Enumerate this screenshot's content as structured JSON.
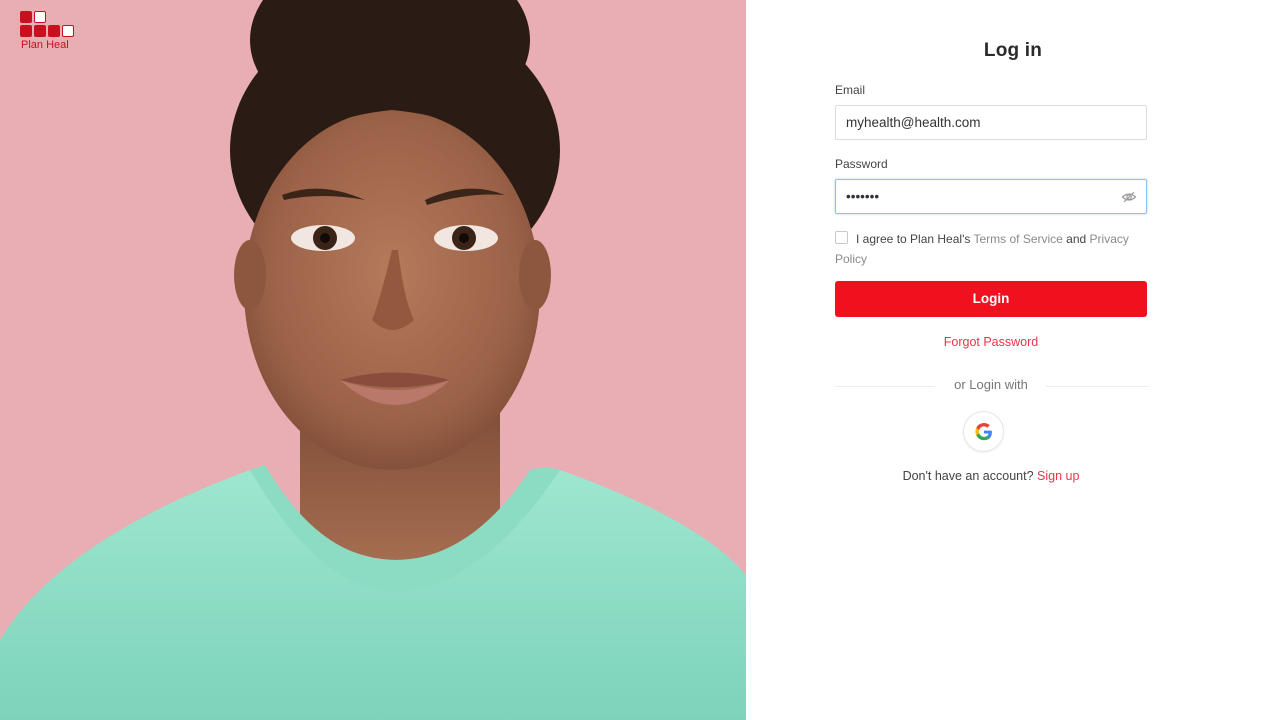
{
  "brand": {
    "name": "Plan Heal",
    "color": "#c8101e"
  },
  "login": {
    "title": "Log in",
    "email_label": "Email",
    "email_value": "myhealth@health.com",
    "password_label": "Password",
    "password_value": "•••••••",
    "password_visibility_icon": "eye-slash-icon",
    "agree_prefix": "I agree to Plan Heal's ",
    "terms_link": "Terms of Service",
    "agree_and": " and ",
    "privacy_link": "Privacy Policy",
    "login_button": "Login",
    "forgot_password": "Forgot Password",
    "or_login_with": "or Login with",
    "google_icon": "google-icon",
    "no_account_text": "Don't have an account? ",
    "signup_link": "Sign up"
  },
  "colors": {
    "accent": "#f0101e",
    "link": "#f0334a",
    "hero_background": "#e8aeb3",
    "focus_border": "#8fc2f0"
  }
}
